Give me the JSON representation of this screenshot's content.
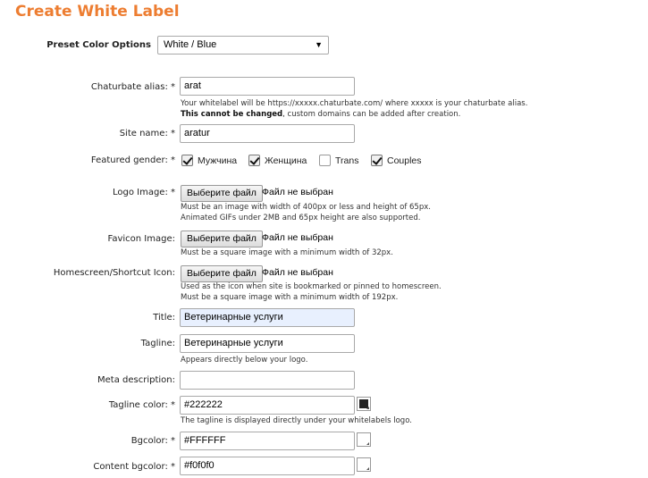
{
  "page": {
    "title": "Create White Label"
  },
  "preset": {
    "label": "Preset Color Options",
    "selected": "White / Blue"
  },
  "alias": {
    "label": "Chaturbate alias: *",
    "value": "arat",
    "help1": "Your whitelabel will be https://xxxxx.chaturbate.com/ where xxxxx is your chaturbate alias.",
    "help2_bold": "This cannot be changed",
    "help2_rest": ", custom domains can be added after creation."
  },
  "site_name": {
    "label": "Site name: *",
    "value": "aratur"
  },
  "gender": {
    "label": "Featured gender: *",
    "options": [
      {
        "label": "Мужчина",
        "checked": true
      },
      {
        "label": "Женщина",
        "checked": true
      },
      {
        "label": "Trans",
        "checked": false
      },
      {
        "label": "Couples",
        "checked": true
      }
    ]
  },
  "file_button_label": "Выберите файл",
  "file_none_label": "Файл не выбран",
  "logo": {
    "label": "Logo Image: *",
    "help1": "Must be an image with width of 400px or less and height of 65px.",
    "help2": "Animated GIFs under 2MB and 65px height are also supported."
  },
  "favicon": {
    "label": "Favicon Image:",
    "help1": "Must be a square image with a minimum width of 32px."
  },
  "homescreen": {
    "label": "Homescreen/Shortcut Icon:",
    "help1": "Used as the icon when site is bookmarked or pinned to homescreen.",
    "help2": "Must be a square image with a minimum width of 192px."
  },
  "title_field": {
    "label": "Title:",
    "value": "Ветеринарные услуги"
  },
  "tagline": {
    "label": "Tagline:",
    "value": "Ветеринарные услуги",
    "help": "Appears directly below your logo."
  },
  "meta": {
    "label": "Meta description:",
    "value": ""
  },
  "tagline_color": {
    "label": "Tagline color: *",
    "value": "#222222",
    "swatch": "#222222",
    "help": "The tagline is displayed directly under your whitelabels logo."
  },
  "bgcolor": {
    "label": "Bgcolor: *",
    "value": "#FFFFFF",
    "swatch": "#FFFFFF"
  },
  "content_bgcolor": {
    "label": "Content bgcolor: *",
    "value": "#f0f0f0",
    "swatch": "#FFFFFF"
  },
  "colors": {
    "accent": "#ed7d31",
    "autofill": "#e8f0fe"
  }
}
